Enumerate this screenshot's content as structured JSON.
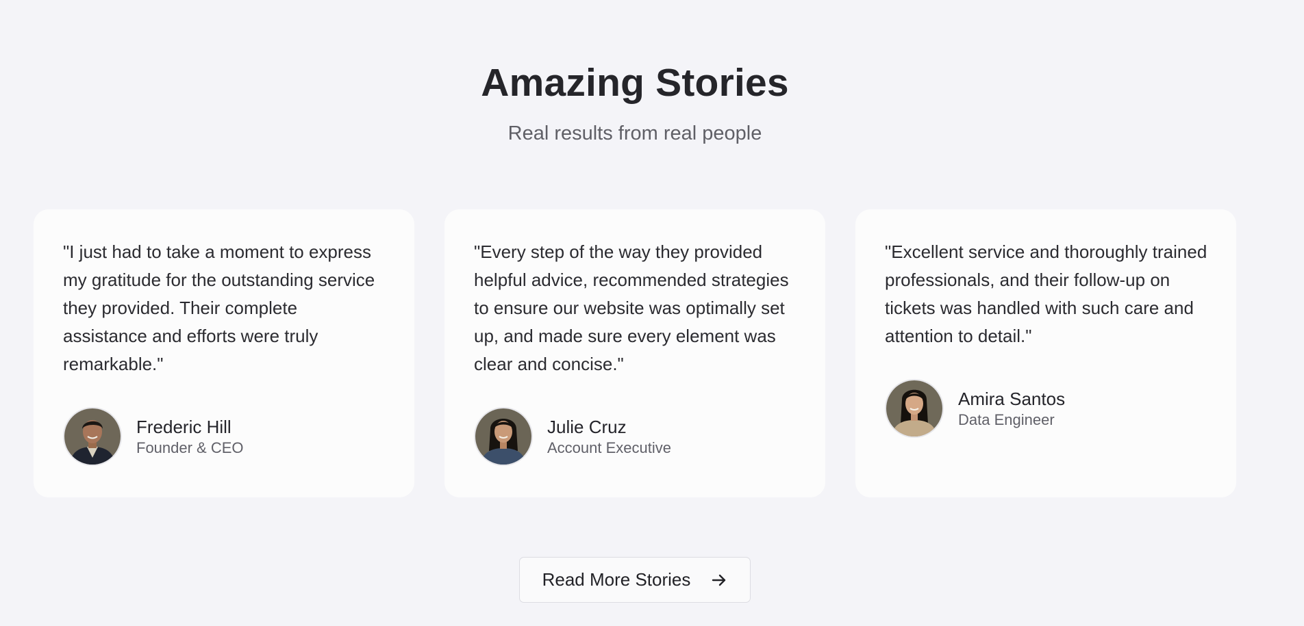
{
  "section": {
    "title": "Amazing Stories",
    "subtitle": "Real results from real people"
  },
  "testimonials": [
    {
      "quote": "\"I just had to take a moment to express my gratitude for the outstanding service they provided. Their complete assistance and efforts were truly remarkable.\"",
      "name": "Frederic Hill",
      "role": "Founder & CEO"
    },
    {
      "quote": "\"Every step of the way they provided helpful advice, recommended strategies to ensure our website was optimally set up, and made sure every element was clear and concise.\"",
      "name": "Julie Cruz",
      "role": "Account Executive"
    },
    {
      "quote": "\"Excellent service and thoroughly trained professionals, and their follow-up on tickets was handled with such care and attention to detail.\"",
      "name": "Amira Santos",
      "role": "Data Engineer"
    }
  ],
  "cta": {
    "label": "Read More Stories",
    "icon": "arrow-right-icon"
  },
  "colors": {
    "background": "#f4f4f8",
    "card": "#fcfcfc",
    "heading": "#25252a",
    "muted": "#5f5f66"
  }
}
